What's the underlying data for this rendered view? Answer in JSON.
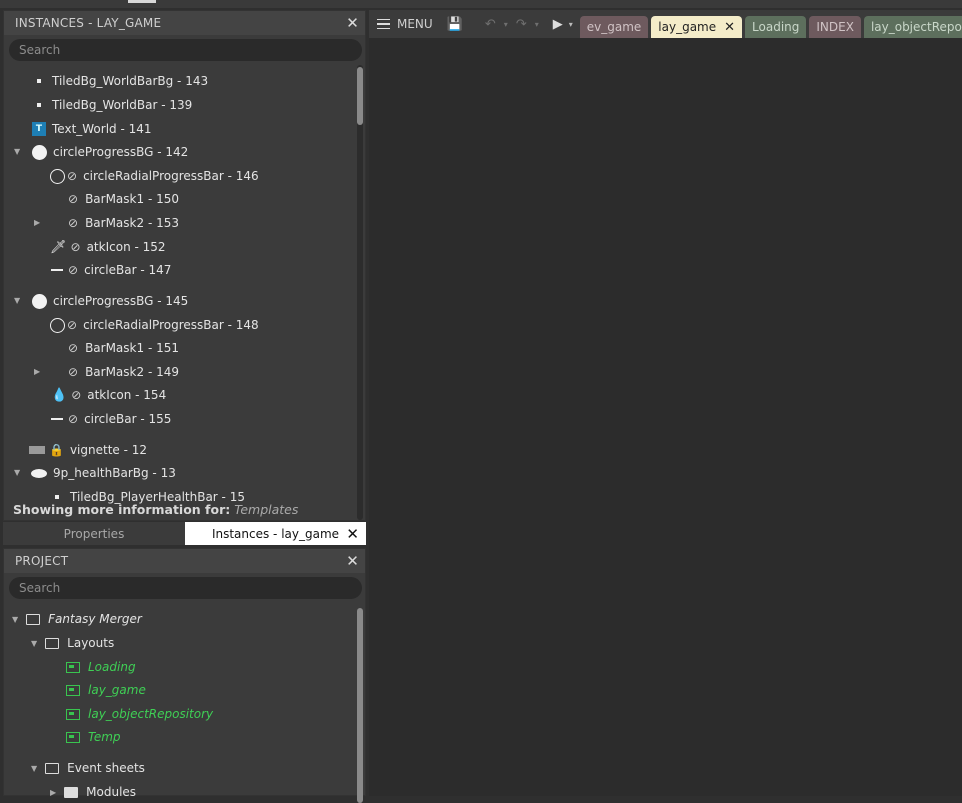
{
  "instances_panel": {
    "title": "INSTANCES - LAY_GAME",
    "search_placeholder": "Search",
    "rows": [
      "TiledBg_WorldBarBg - 143",
      "TiledBg_WorldBar - 139",
      "Text_World - 141",
      "circleProgressBG - 142",
      "circleRadialProgressBar - 146",
      "BarMask1 - 150",
      "BarMask2 - 153",
      "atkIcon - 152",
      "circleBar - 147",
      "circleProgressBG - 145",
      "circleRadialProgressBar - 148",
      "BarMask1 - 151",
      "BarMask2 - 149",
      "atkIcon - 154",
      "circleBar - 155",
      "vignette - 12",
      "9p_healthBarBg - 13",
      "TiledBg_PlayerHealthBar - 15"
    ],
    "more_info_label": "Showing more information for:",
    "more_info_value": "Templates"
  },
  "bottom_tabs": {
    "properties": "Properties",
    "instances": "Instances - lay_game"
  },
  "project_panel": {
    "title": "PROJECT",
    "search_placeholder": "Search",
    "root": "Fantasy Merger",
    "layouts_folder": "Layouts",
    "layouts": [
      "Loading",
      "lay_game",
      "lay_objectRepository",
      "Temp"
    ],
    "event_sheets_folder": "Event sheets",
    "modules_folder": "Modules"
  },
  "toolbar": {
    "menu_label": "MENU",
    "tabs": [
      {
        "label": "ev_game",
        "bg": "#6e5a5e",
        "fg": "#d0c3c5"
      },
      {
        "label": "lay_game",
        "bg": "#f4ecc9",
        "fg": "#222222",
        "active": true
      },
      {
        "label": "Loading",
        "bg": "#5d6f5d",
        "fg": "#c9d7c9"
      },
      {
        "label": "INDEX",
        "bg": "#6e5a5e",
        "fg": "#d0c3c5"
      },
      {
        "label": "lay_objectReposit",
        "bg": "#5d6f5d",
        "fg": "#c9d7c9"
      }
    ]
  },
  "colors": {
    "layout_green": "#3fcf55",
    "panel_bg": "#3b3b3b",
    "main_bg": "#2c2c2c"
  }
}
